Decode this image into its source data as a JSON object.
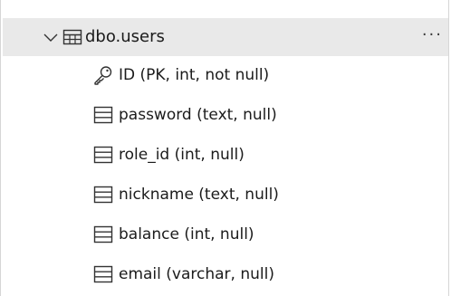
{
  "table": {
    "name": "dbo.users",
    "more_label": "···",
    "icon": "table-icon",
    "expanded": true
  },
  "columns": [
    {
      "label": "ID (PK, int, not null)",
      "icon": "key-icon"
    },
    {
      "label": "password (text, null)",
      "icon": "column-icon"
    },
    {
      "label": "role_id (int, null)",
      "icon": "column-icon"
    },
    {
      "label": "nickname (text, null)",
      "icon": "column-icon"
    },
    {
      "label": "balance (int, null)",
      "icon": "column-icon"
    },
    {
      "label": "email (varchar, null)",
      "icon": "column-icon"
    }
  ]
}
